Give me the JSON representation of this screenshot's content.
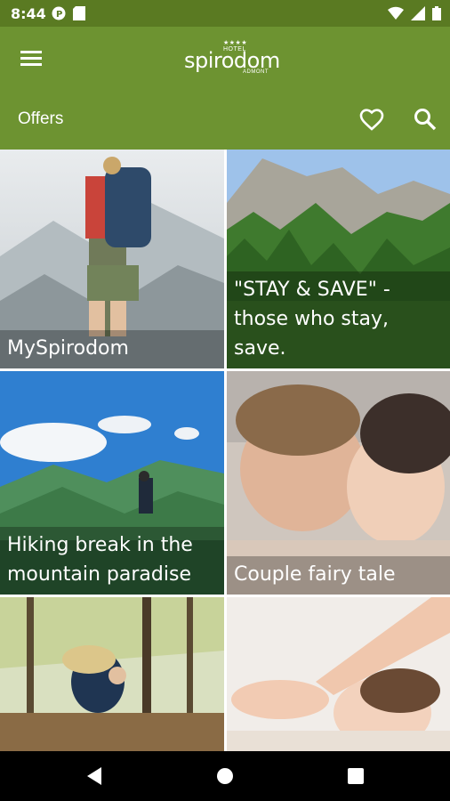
{
  "status": {
    "time": "8:44"
  },
  "app_bar": {
    "logo": {
      "top": "★★★★ HOTEL",
      "name": "spirodom",
      "bottom": "ADMONT"
    },
    "title": "Offers"
  },
  "offers": [
    {
      "title": "MySpirodom"
    },
    {
      "title": "\"STAY & SAVE\" - those who stay, save."
    },
    {
      "title": "Hiking break in the mountain paradise"
    },
    {
      "title": "Couple fairy tale"
    },
    {
      "title": ""
    },
    {
      "title": ""
    }
  ],
  "icons": {
    "menu": "menu-icon",
    "favorite": "heart-icon",
    "search": "search-icon",
    "back": "back-icon",
    "home": "home-icon",
    "recents": "recents-icon"
  },
  "colors": {
    "status_bar": "#5a7a22",
    "app_bar": "#6d9331"
  }
}
